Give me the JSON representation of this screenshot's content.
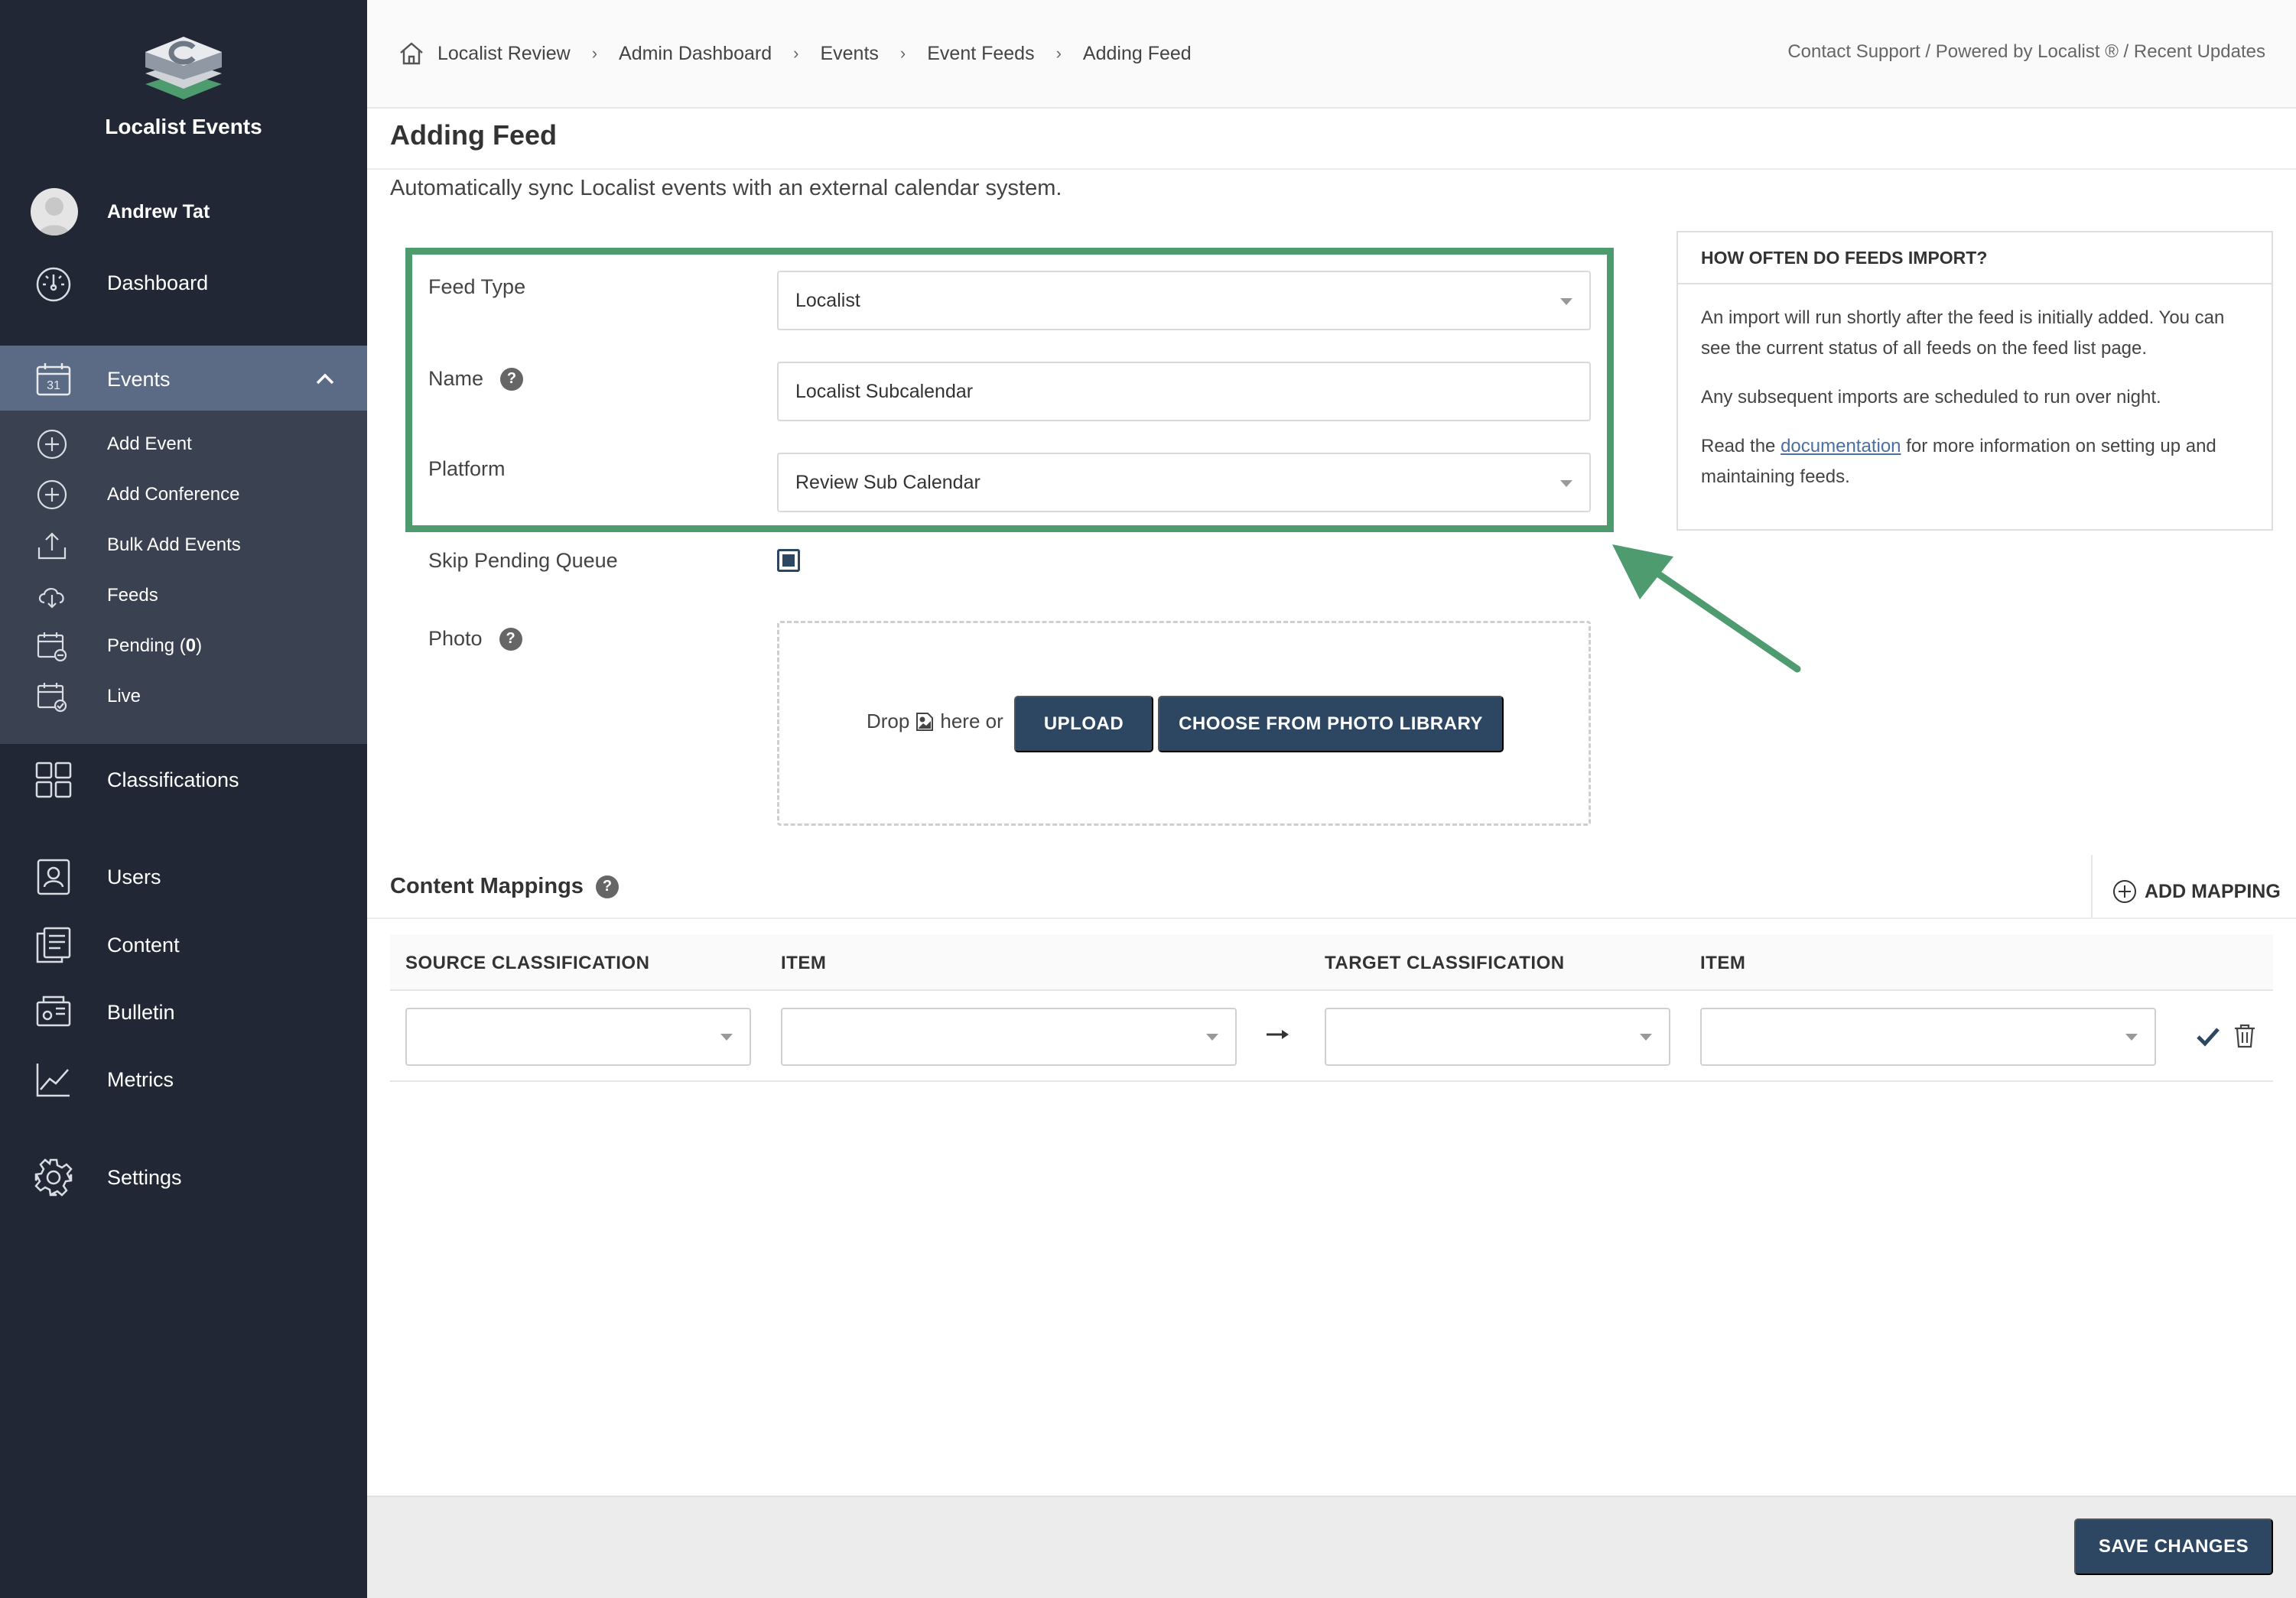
{
  "sidebar": {
    "brand": "Localist Events",
    "user_name": "Andrew Tat",
    "nav": {
      "dashboard": "Dashboard",
      "events": "Events",
      "classifications": "Classifications",
      "users": "Users",
      "content": "Content",
      "bulletin": "Bulletin",
      "metrics": "Metrics",
      "settings": "Settings"
    },
    "events_sub": {
      "add_event": "Add Event",
      "add_conference": "Add Conference",
      "bulk_add_events": "Bulk Add Events",
      "feeds": "Feeds",
      "pending": "Pending",
      "pending_count": "0",
      "live": "Live"
    },
    "calendar_day": "31"
  },
  "topbar": {
    "breadcrumb": [
      "Localist Review",
      "Admin Dashboard",
      "Events",
      "Event Feeds",
      "Adding Feed"
    ],
    "separator": "›",
    "links": "Contact Support / Powered by Localist ® / Recent Updates"
  },
  "page": {
    "title": "Adding Feed",
    "description": "Automatically sync Localist events with an external calendar system."
  },
  "form": {
    "feed_type_label": "Feed Type",
    "feed_type_value": "Localist",
    "name_label": "Name",
    "name_value": "Localist Subcalendar",
    "platform_label": "Platform",
    "platform_value": "Review Sub Calendar",
    "skip_pending_label": "Skip Pending Queue",
    "skip_pending_checked": true,
    "photo_label": "Photo",
    "drop_prefix": "Drop",
    "drop_suffix": "here or",
    "upload_label": "UPLOAD",
    "library_label": "CHOOSE FROM PHOTO LIBRARY",
    "help_glyph": "?"
  },
  "info": {
    "heading": "HOW OFTEN DO FEEDS IMPORT?",
    "p1": "An import will run shortly after the feed is initially added. You can see the current status of all feeds on the feed list page.",
    "p2": "Any subsequent imports are scheduled to run over night.",
    "p3_prefix": "Read the",
    "p3_link": "documentation",
    "p3_suffix": "for more information on setting up and maintaining feeds."
  },
  "mappings": {
    "title": "Content Mappings",
    "add_label": "ADD MAPPING",
    "columns": [
      "SOURCE CLASSIFICATION",
      "ITEM",
      "TARGET CLASSIFICATION",
      "ITEM"
    ]
  },
  "footer": {
    "save_label": "SAVE CHANGES"
  },
  "colors": {
    "sidebar_bg": "#212734",
    "sidebar_active": "#5b6a85",
    "sidebar_sub_bg": "#3a4150",
    "button_primary": "#2d4763",
    "highlight_green": "#4e9b70"
  }
}
